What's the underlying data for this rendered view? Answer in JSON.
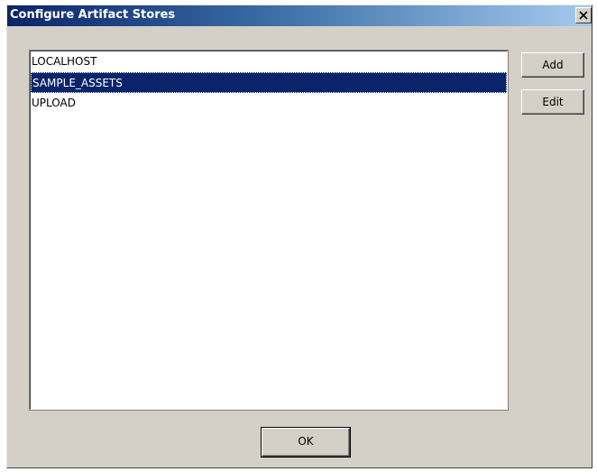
{
  "dialog": {
    "title": "Configure Artifact Stores",
    "close_icon": "close-icon"
  },
  "stores": {
    "items": [
      {
        "label": "LOCALHOST",
        "selected": false
      },
      {
        "label": "SAMPLE_ASSETS",
        "selected": true
      },
      {
        "label": "UPLOAD",
        "selected": false
      }
    ]
  },
  "buttons": {
    "add_label": "Add",
    "edit_label": "Edit",
    "ok_label": "OK"
  },
  "colors": {
    "dialog_bg": "#d4d0c8",
    "titlebar_start": "#0a246a",
    "titlebar_end": "#a6caf0",
    "selection_bg": "#0a246a",
    "selection_text": "#ffffff"
  }
}
